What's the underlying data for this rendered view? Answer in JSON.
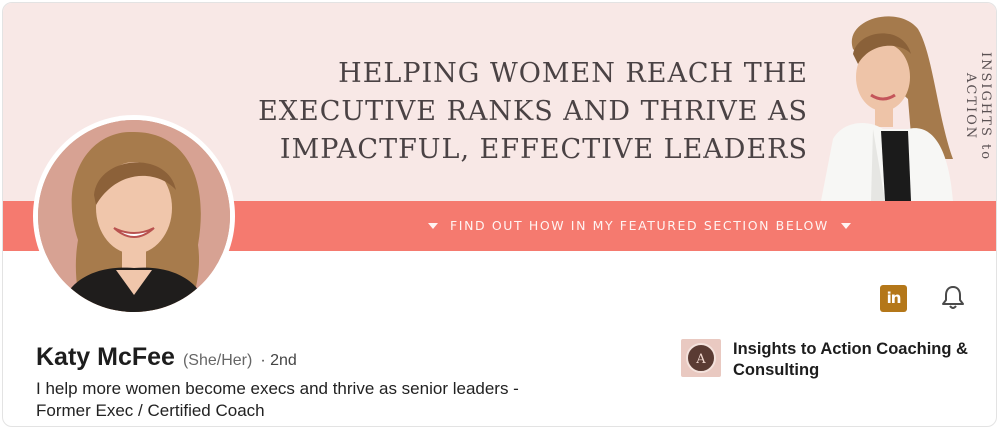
{
  "banner": {
    "headline_line1": "HELPING WOMEN REACH THE",
    "headline_highlight": "EXECUTIVE RANKS AND THRIVE",
    "headline_line2_rest": " AS",
    "headline_line3": "IMPACTFUL, EFFECTIVE LEADERS",
    "cta": "FIND OUT HOW IN MY FEATURED SECTION BELOW",
    "brand_vertical": "INSIGHTS to ACTION",
    "bar_color": "#f57a6f",
    "background_color": "#f8e8e6"
  },
  "profile": {
    "name": "Katy McFee",
    "pronouns": "(She/Her)",
    "degree": "· 2nd",
    "headline_line1": "I help more women become execs and thrive as senior leaders -",
    "headline_line2": "Former Exec / Certified Coach"
  },
  "actions": {
    "linkedin_icon_text": "in",
    "linkedin_icon": "linkedin-icon",
    "bell_icon": "bell-icon"
  },
  "company": {
    "name": "Insights to Action Coaching & Consulting",
    "logo_letter": "A"
  }
}
